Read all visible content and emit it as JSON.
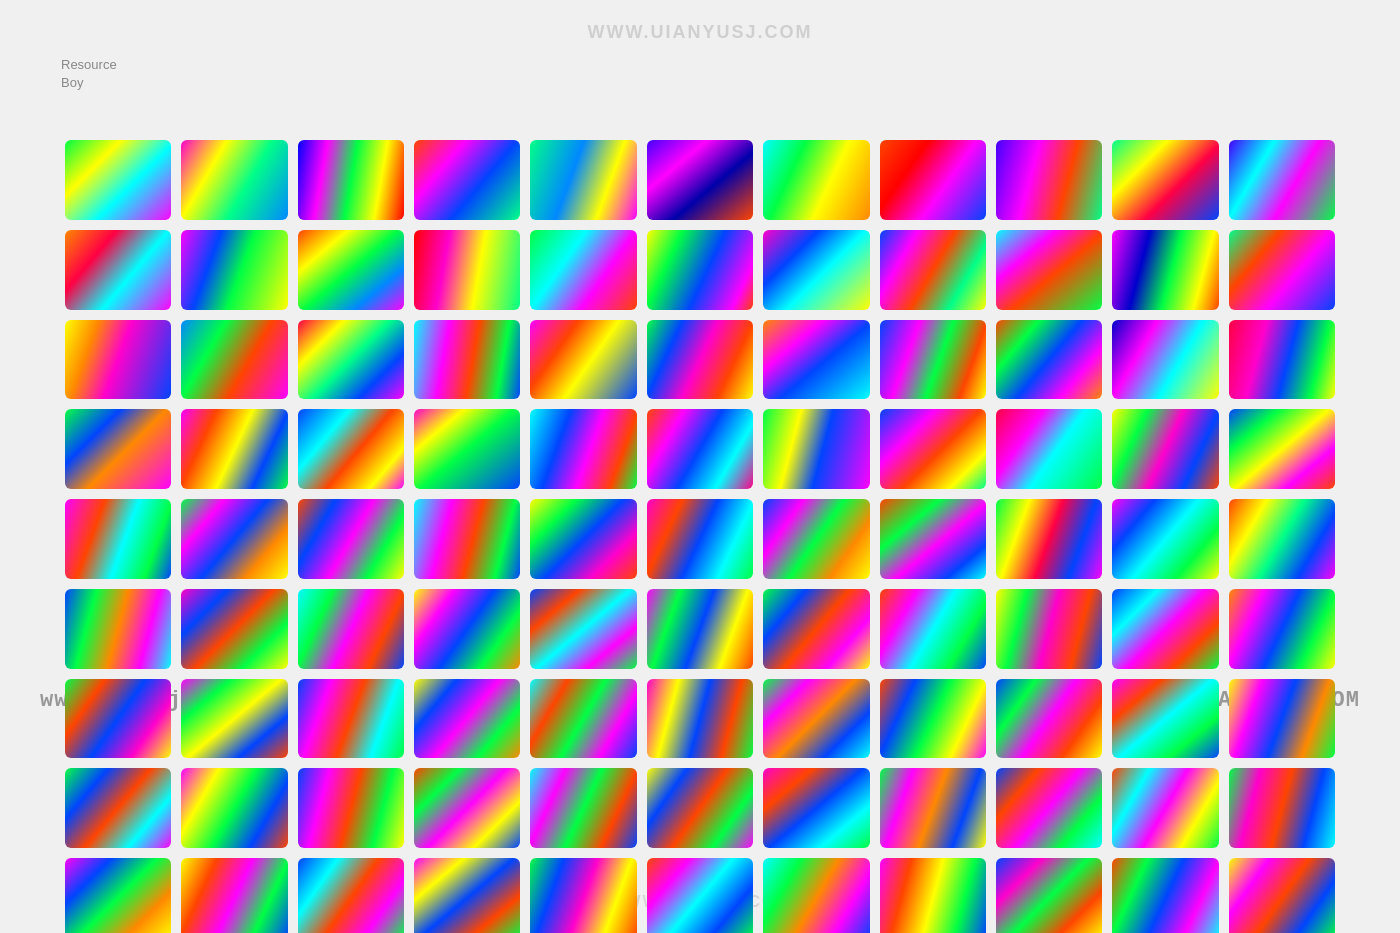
{
  "logo": {
    "line1": "Resource",
    "line2": "Boy"
  },
  "watermarks": {
    "top": "WWW.UIANYUSJ.COM",
    "left": "www.anyusj.com",
    "right": "www.ANYUSJ.COM",
    "bottom": "WWW.ANYUSJ.COM"
  },
  "gradients": [
    "linear-gradient(135deg, #00ff44 0%, #ffff00 30%, #00ffff 60%, #ff00ff 100%)",
    "linear-gradient(120deg, #ff00cc 0%, #ffff00 30%, #00ff88 60%, #0088ff 100%)",
    "linear-gradient(100deg, #0000ff 0%, #ff00ff 25%, #00ff44 50%, #ffff00 75%, #ff0000 100%)",
    "linear-gradient(130deg, #ff4400 0%, #ff00ff 30%, #0044ff 60%, #00ff88 100%)",
    "linear-gradient(110deg, #00ff88 0%, #0088ff 40%, #ffff00 70%, #ff00ff 100%)",
    "linear-gradient(140deg, #4400ff 0%, #ff00ff 30%, #0000aa 60%, #ff4400 100%)",
    "linear-gradient(115deg, #00ffff 0%, #00ff44 30%, #ffff00 60%, #ff8800 100%)",
    "linear-gradient(125deg, #ff4400 0%, #ff0000 30%, #ff00ff 60%, #0044ff 100%)",
    "linear-gradient(105deg, #4400ff 0%, #ff00ff 35%, #ff4400 65%, #00ff88 100%)",
    "linear-gradient(135deg, #00ff88 0%, #ffff00 30%, #ff0044 60%, #0044ff 100%)",
    "linear-gradient(120deg, #4400ff 0%, #00ffff 30%, #ff00ff 60%, #00ff44 100%)",
    "linear-gradient(130deg, #ff8800 0%, #ff0044 30%, #00ffff 60%, #ff00ff 100%)",
    "linear-gradient(110deg, #ff00ff 0%, #0044ff 30%, #00ff44 55%, #ffff00 100%)",
    "linear-gradient(140deg, #ff4400 0%, #ffff00 25%, #00ff44 50%, #0088ff 75%, #ff00ff 100%)",
    "linear-gradient(100deg, #ff0000 0%, #ff00cc 30%, #ffff00 60%, #00ff88 100%)",
    "linear-gradient(125deg, #00ff44 0%, #00ffff 35%, #ff00ff 65%, #ff4400 100%)",
    "linear-gradient(115deg, #ffff00 0%, #00ff44 25%, #0044ff 55%, #ff00ff 85%, #ff4400 100%)",
    "linear-gradient(135deg, #ff00cc 0%, #0044ff 30%, #00ffff 55%, #ffff00 100%)",
    "linear-gradient(120deg, #0044ff 0%, #ff00ff 25%, #ff4400 50%, #00ff88 75%, #ffff00 100%)",
    "linear-gradient(140deg, #00ffff 0%, #ff00ff 30%, #ff4400 55%, #00ff44 100%)",
    "linear-gradient(105deg, #ff00ff 0%, #0000cc 30%, #00ff44 55%, #ffff00 80%, #ff4400 100%)",
    "linear-gradient(130deg, #00ff88 0%, #ff4400 30%, #ff00ff 60%, #0044ff 100%)",
    "linear-gradient(110deg, #ffff00 0%, #ff8800 25%, #ff00cc 50%, #0044ff 100%)",
    "linear-gradient(120deg, #0088ff 0%, #00ff44 30%, #ff4400 60%, #ff00ff 100%)",
    "linear-gradient(135deg, #ff0044 0%, #ffff00 25%, #00ff88 50%, #0044ff 75%, #ff00ff 100%)",
    "linear-gradient(100deg, #00ffff 0%, #ff00ff 30%, #ff4400 55%, #00ff44 80%, #0044ff 100%)",
    "linear-gradient(125deg, #ff00ff 0%, #ff4400 30%, #ffff00 55%, #0044ff 100%)",
    "linear-gradient(115deg, #00ff44 0%, #0044ff 25%, #ff00cc 50%, #ff4400 75%, #ffff00 100%)",
    "linear-gradient(140deg, #ff8800 0%, #ff00ff 30%, #0044ff 55%, #00ffff 100%)",
    "linear-gradient(110deg, #0044ff 0%, #ff00ff 30%, #00ff44 55%, #ff4400 80%, #ffff00 100%)",
    "linear-gradient(130deg, #ff4400 0%, #00ff44 25%, #0044ff 50%, #ff00ff 75%, #ff8800 100%)",
    "linear-gradient(120deg, #0000cc 0%, #ff00ff 30%, #00ffff 60%, #ffff00 100%)",
    "linear-gradient(105deg, #ff0044 0%, #ff00cc 30%, #0044ff 55%, #00ff44 80%, #ffff00 100%)",
    "linear-gradient(135deg, #00ff44 0%, #0044ff 30%, #ff8800 55%, #ff00ff 100%)",
    "linear-gradient(115deg, #ff00ff 0%, #ff4400 25%, #ffff00 50%, #0044ff 75%, #00ff44 100%)",
    "linear-gradient(130deg, #0044ff 0%, #00ffff 30%, #ff4400 55%, #ffff00 80%, #ff00ff 100%)",
    "linear-gradient(140deg, #ff00cc 0%, #ffff00 25%, #00ff44 50%, #0044ff 100%)",
    "linear-gradient(110deg, #00ffff 0%, #0044ff 30%, #ff00ff 55%, #ff4400 80%, #00ff44 100%)",
    "linear-gradient(120deg, #ff4400 0%, #ff00ff 25%, #0044ff 50%, #00ffff 75%, #ff0088 100%)",
    "linear-gradient(105deg, #00ff44 0%, #ffff00 30%, #0044ff 55%, #ff00ff 100%)",
    "linear-gradient(135deg, #0044ff 0%, #ff00ff 30%, #ff4400 55%, #ffff00 80%, #00ff88 100%)",
    "linear-gradient(125deg, #ff0044 0%, #ff00ff 30%, #00ffff 55%, #00ff44 100%)",
    "linear-gradient(115deg, #ffff00 0%, #00ff44 25%, #ff00cc 50%, #0044ff 75%, #ff4400 100%)",
    "linear-gradient(140deg, #0044ff 0%, #00ff44 25%, #ffff00 50%, #ff00ff 75%, #ff4400 100%)",
    "linear-gradient(110deg, #ff00ff 0%, #ff4400 30%, #00ffff 55%, #00ff44 80%, #0044ff 100%)",
    "linear-gradient(130deg, #00ff44 0%, #ff00ff 25%, #0044ff 50%, #ff8800 75%, #ffff00 100%)",
    "linear-gradient(120deg, #ff4400 0%, #0044ff 25%, #ff00ff 50%, #00ff44 75%, #ffff00 100%)",
    "linear-gradient(105deg, #00ffff 0%, #ff00ff 30%, #ff4400 55%, #00ff44 80%, #0044ff 100%)",
    "linear-gradient(135deg, #ffff00 0%, #00ff44 25%, #0044ff 50%, #ff00cc 75%, #ff4400 100%)",
    "linear-gradient(115deg, #ff00cc 0%, #ff4400 25%, #0044ff 50%, #00ffff 75%, #00ff44 100%)",
    "linear-gradient(125deg, #0044ff 0%, #ff00ff 25%, #00ff44 50%, #ff8800 75%, #ffff00 100%)",
    "linear-gradient(140deg, #ff4400 0%, #00ff44 30%, #ff00ff 55%, #0044ff 80%, #00ffff 100%)",
    "linear-gradient(110deg, #00ff44 0%, #ffff00 25%, #ff0044 50%, #0044ff 75%, #ff00ff 100%)",
    "linear-gradient(130deg, #ff00ff 0%, #0044ff 25%, #00ffff 50%, #00ff44 75%, #ffff00 100%)",
    "linear-gradient(120deg, #ff4400 0%, #ffff00 25%, #00ff88 50%, #0044ff 75%, #ff00ff 100%)",
    "linear-gradient(105deg, #0044ff 0%, #00ff44 25%, #ff8800 50%, #ff00ff 75%, #00ffff 100%)",
    "linear-gradient(135deg, #ff00cc 0%, #0044ff 25%, #ff4400 50%, #00ff44 75%, #ffff00 100%)",
    "linear-gradient(115deg, #00ffff 0%, #00ff44 25%, #ff00ff 50%, #ff4400 75%, #0044ff 100%)",
    "linear-gradient(125deg, #ffff00 0%, #ff00ff 25%, #0044ff 50%, #00ff44 75%, #ff8800 100%)",
    "linear-gradient(140deg, #0044ff 0%, #ff4400 25%, #00ffff 50%, #ff00ff 75%, #00ff44 100%)",
    "linear-gradient(110deg, #ff00ff 0%, #00ff44 25%, #0044ff 50%, #ffff00 75%, #ff4400 100%)",
    "linear-gradient(130deg, #00ff44 0%, #0044ff 25%, #ff4400 50%, #ff00ff 75%, #ffff00 100%)",
    "linear-gradient(120deg, #ff4400 0%, #ff00ff 25%, #00ffff 50%, #00ff44 75%, #0044ff 100%)",
    "linear-gradient(105deg, #ffff00 0%, #00ff44 25%, #ff00cc 50%, #ff4400 75%, #0044ff 100%)",
    "linear-gradient(135deg, #0044ff 0%, #00ffff 25%, #ff00ff 50%, #ff4400 75%, #00ff44 100%)",
    "linear-gradient(115deg, #ff8800 0%, #ff00ff 25%, #0044ff 50%, #00ff44 75%, #ffff00 100%)",
    "linear-gradient(125deg, #00ff44 0%, #ff4400 25%, #0044ff 50%, #ff00cc 75%, #ffff00 100%)",
    "linear-gradient(140deg, #ff00ff 0%, #00ff44 25%, #ffff00 50%, #0044ff 75%, #ff4400 100%)",
    "linear-gradient(110deg, #0044ff 0%, #ff00ff 25%, #ff4400 50%, #00ffff 75%, #00ff44 100%)",
    "linear-gradient(130deg, #ffff00 0%, #0044ff 25%, #ff00ff 50%, #00ff44 75%, #ff8800 100%)",
    "linear-gradient(120deg, #00ffff 0%, #ff4400 25%, #00ff44 50%, #ff00ff 75%, #0044ff 100%)",
    "linear-gradient(105deg, #ff00cc 0%, #ffff00 25%, #0044ff 50%, #ff4400 75%, #00ff44 100%)",
    "linear-gradient(135deg, #00ff44 0%, #ff00ff 25%, #ff8800 50%, #0044ff 75%, #00ffff 100%)",
    "linear-gradient(115deg, #ff4400 0%, #0044ff 25%, #00ff44 50%, #ffff00 75%, #ff00ff 100%)",
    "linear-gradient(125deg, #0044ff 0%, #00ff44 25%, #ff00ff 50%, #ff4400 75%, #ffff00 100%)",
    "linear-gradient(140deg, #ff00ff 0%, #ff4400 25%, #00ffff 50%, #00ff44 75%, #0044ff 100%)",
    "linear-gradient(110deg, #ffff00 0%, #ff00ff 25%, #0044ff 50%, #ff8800 75%, #00ff44 100%)",
    "linear-gradient(130deg, #00ff44 0%, #0044ff 25%, #ff4400 50%, #00ffff 75%, #ff00ff 100%)",
    "linear-gradient(120deg, #ff00ff 0%, #ffff00 25%, #00ff44 50%, #0044ff 75%, #ff4400 100%)",
    "linear-gradient(105deg, #0044ff 0%, #ff00ff 25%, #ff4400 50%, #00ff44 75%, #ffff00 100%)",
    "linear-gradient(135deg, #ff4400 0%, #00ff44 25%, #ff00ff 50%, #ffff00 75%, #0044ff 100%)",
    "linear-gradient(115deg, #00ffff 0%, #ff00ff 25%, #00ff44 50%, #ff4400 75%, #0044ff 100%)",
    "linear-gradient(125deg, #ffff00 0%, #0044ff 25%, #ff4400 50%, #00ff44 75%, #ff00ff 100%)",
    "linear-gradient(140deg, #ff00cc 0%, #ff4400 25%, #0044ff 50%, #00ffff 75%, #00ff44 100%)",
    "linear-gradient(110deg, #00ff44 0%, #ff00ff 25%, #ff8800 50%, #0044ff 75%, #ffff00 100%)",
    "linear-gradient(130deg, #0044ff 0%, #ff4400 25%, #ff00ff 50%, #00ff44 75%, #00ffff 100%)",
    "linear-gradient(120deg, #ff4400 0%, #00ffff 25%, #ff00ff 50%, #ffff00 75%, #00ff44 100%)",
    "linear-gradient(105deg, #00ff44 0%, #ff00cc 25%, #ff4400 50%, #0044ff 75%, #00ffff 100%)",
    "linear-gradient(135deg, #ff00ff 0%, #0044ff 25%, #00ff44 50%, #ff8800 75%, #ffff00 100%)",
    "linear-gradient(115deg, #ffff00 0%, #ff4400 25%, #ff00ff 50%, #00ff44 75%, #0044ff 100%)",
    "linear-gradient(125deg, #0044ff 0%, #00ffff 25%, #ff4400 50%, #ff00ff 75%, #00ff44 100%)",
    "linear-gradient(140deg, #ff00ff 0%, #ffff00 25%, #0044ff 50%, #ff4400 75%, #00ff44 100%)",
    "linear-gradient(110deg, #00ff44 0%, #0044ff 25%, #ff00cc 50%, #ffff00 75%, #ff4400 100%)",
    "linear-gradient(130deg, #ff4400 0%, #ff00ff 25%, #00ffff 50%, #0044ff 75%, #00ff44 100%)",
    "linear-gradient(120deg, #00ffff 0%, #00ff44 25%, #ff8800 50%, #ff00ff 75%, #0044ff 100%)",
    "linear-gradient(105deg, #ff00ff 0%, #ff4400 25%, #ffff00 50%, #00ff44 75%, #0044ff 100%)",
    "linear-gradient(135deg, #0044ff 0%, #ff00cc 25%, #00ff44 50%, #ff4400 75%, #ffff00 100%)",
    "linear-gradient(115deg, #ff4400 0%, #00ff44 25%, #0044ff 50%, #ff00ff 75%, #00ffff 100%)",
    "linear-gradient(125deg, #ffff00 0%, #ff00ff 25%, #ff4400 50%, #0044ff 75%, #00ff44 100%)",
    "linear-gradient(140deg, #00ff44 0%, #ff4400 25%, #ff00ff 50%, #00ffff 75%, #0044ff 100%)",
    "linear-gradient(110deg, #0044ff 0%, #ffff00 25%, #00ff44 50%, #ff00cc 75%, #ff4400 100%)",
    "linear-gradient(130deg, #ff00ff 0%, #00ff44 25%, #0044ff 50%, #ff4400 75%, #00ffff 100%)",
    "linear-gradient(120deg, #ff4400 0%, #0044ff 25%, #ff00ff 50%, #ffff00 75%, #00ff44 100%)",
    "linear-gradient(105deg, #00ff44 0%, #00ffff 25%, #ff00cc 50%, #ff4400 75%, #0044ff 100%)",
    "linear-gradient(135deg, #ff00ff 0%, #ff8800 25%, #0044ff 50%, #00ff44 75%, #ffff00 100%)",
    "linear-gradient(115deg, #0044ff 0%, #ff4400 25%, #00ff44 50%, #ff00ff 75%, #00ffff 100%)",
    "linear-gradient(125deg, #ffff00 0%, #00ff44 25%, #ff4400 50%, #0044ff 75%, #ff00cc 100%)",
    "linear-gradient(140deg, #00ffff 0%, #ff00ff 25%, #ff4400 50%, #00ff44 75%, #0044ff 100%)",
    "linear-gradient(110deg, #ff4400 0%, #0044ff 25%, #ff00ff 50%, #00ffff 75%, #00ff44 100%)",
    "linear-gradient(130deg, #00ff44 0%, #ffff00 25%, #ff00ff 50%, #ff4400 75%, #0044ff 100%)"
  ]
}
